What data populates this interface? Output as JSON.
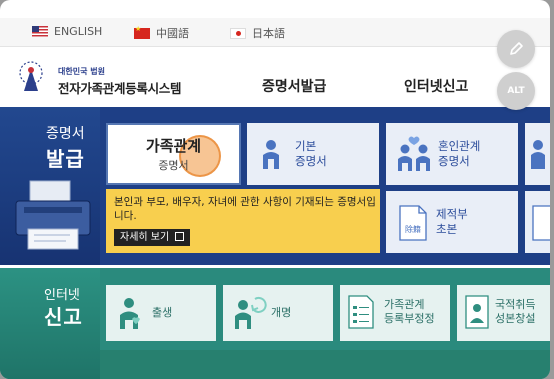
{
  "languages": [
    {
      "label": "ENGLISH",
      "flag": "us-flag-icon"
    },
    {
      "label": "中國語",
      "flag": "china-flag-icon"
    },
    {
      "label": "日本語",
      "flag": "japan-flag-icon"
    }
  ],
  "header": {
    "logo_small": "대한민국 법원",
    "logo_title": "전자가족관계등록시스템",
    "nav": [
      "증명서발급",
      "인터넷신고"
    ]
  },
  "fab": {
    "edit_icon": "pencil-icon",
    "alt_label": "ALT"
  },
  "certificate": {
    "side_line1": "증명서",
    "side_line2": "발급",
    "cards": [
      {
        "line1": "가족관계",
        "line2": "증명서"
      },
      {
        "line1": "기본",
        "line2": "증명서"
      },
      {
        "line1": "혼인관계",
        "line2": "증명서"
      },
      {
        "line1": "제적부",
        "line2": "초본"
      }
    ],
    "tooltip": {
      "text": "본인과 부모, 배우자, 자녀에 관한 사항이 기재되는 증명서입니다.",
      "button": "자세히 보기"
    }
  },
  "report": {
    "side_line1": "인터넷",
    "side_line2": "신고",
    "cards": [
      {
        "label": "출생"
      },
      {
        "label": "개명"
      },
      {
        "line1": "가족관계",
        "line2": "등록부정정"
      },
      {
        "line1": "국적취득",
        "line2": "성본창설"
      }
    ]
  },
  "colors": {
    "cert_bg": "#1e3f86",
    "report_bg": "#2a8a7d",
    "tooltip_bg": "#f8cf4e",
    "accent": "#2b4c9b"
  }
}
